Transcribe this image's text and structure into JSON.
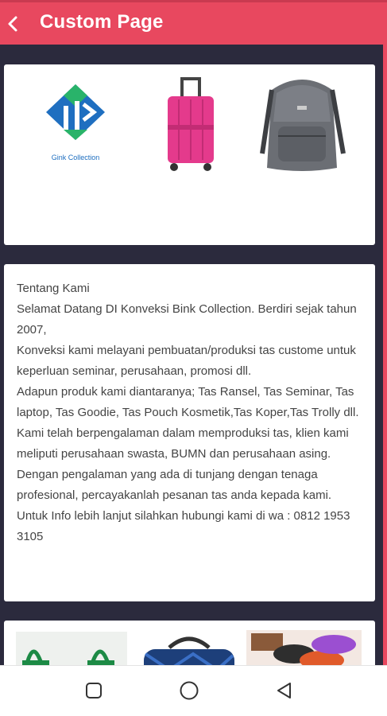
{
  "app_bar": {
    "title": "Custom Page",
    "back_icon": "chevron-left-icon",
    "color": "#e8485f"
  },
  "gallery": {
    "logo_caption": "Gink Collection",
    "items": [
      "brand-logo",
      "pink-suitcase",
      "grey-backpack"
    ]
  },
  "about": {
    "heading": "Tentang Kami",
    "paragraphs": [
      "Selamat Datang DI Konveksi Bink Collection. Berdiri sejak tahun 2007,",
      "Konveksi kami melayani pembuatan/produksi tas custome untuk keperluan seminar, perusahaan, promosi dll.",
      "Adapun produk kami diantaranya; Tas Ransel, Tas Seminar, Tas laptop, Tas Goodie, Tas Pouch Kosmetik,Tas Koper,Tas Trolly dll.",
      "Kami telah berpengalaman dalam memproduksi tas, klien kami meliputi perusahaan swasta, BUMN dan perusahaan asing.",
      "Dengan pengalaman yang ada di tunjang dengan tenaga profesional, percayakanlah pesanan tas anda kepada kami.",
      "Untuk Info lebih lanjut silahkan hubungi kami di wa : 0812 1953 3105"
    ]
  },
  "product_strip": {
    "items": [
      "green-tote-bags",
      "blue-duffel-bag",
      "cosmetic-pouches"
    ]
  },
  "system_nav": {
    "buttons": [
      "recent-apps-icon",
      "home-icon",
      "back-triangle-icon"
    ]
  }
}
